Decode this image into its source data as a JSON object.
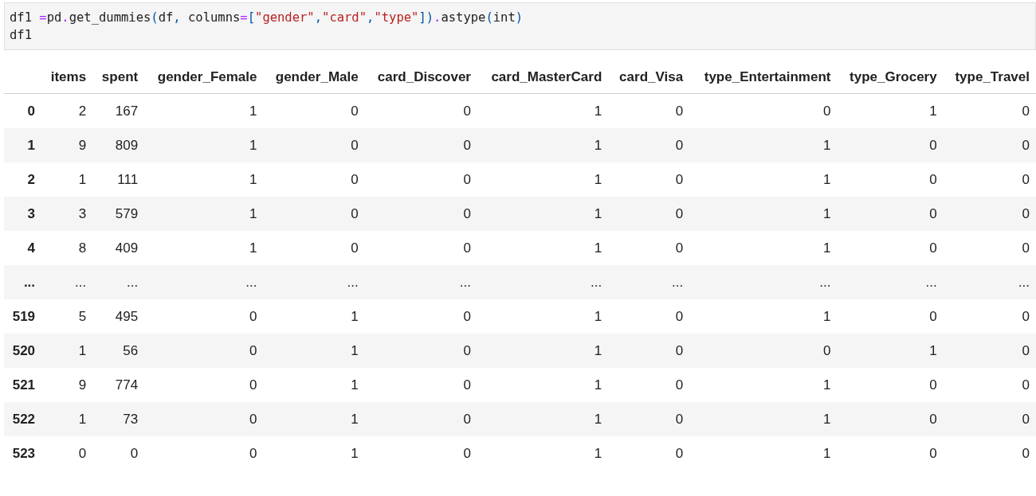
{
  "code_cell": {
    "lines": [
      [
        {
          "kind": "name",
          "text": "df1 "
        },
        {
          "kind": "op",
          "text": "="
        },
        {
          "kind": "name",
          "text": "pd"
        },
        {
          "kind": "op",
          "text": "."
        },
        {
          "kind": "name",
          "text": "get_dummies"
        },
        {
          "kind": "punct",
          "text": "("
        },
        {
          "kind": "name",
          "text": "df"
        },
        {
          "kind": "punct",
          "text": ","
        },
        {
          "kind": "name",
          "text": " columns"
        },
        {
          "kind": "op",
          "text": "="
        },
        {
          "kind": "punct",
          "text": "["
        },
        {
          "kind": "string",
          "text": "\"gender\""
        },
        {
          "kind": "punct",
          "text": ","
        },
        {
          "kind": "string",
          "text": "\"card\""
        },
        {
          "kind": "punct",
          "text": ","
        },
        {
          "kind": "string",
          "text": "\"type\""
        },
        {
          "kind": "punct",
          "text": "])"
        },
        {
          "kind": "op",
          "text": "."
        },
        {
          "kind": "name",
          "text": "astype"
        },
        {
          "kind": "punct",
          "text": "("
        },
        {
          "kind": "name",
          "text": "int"
        },
        {
          "kind": "punct",
          "text": ")"
        }
      ],
      [
        {
          "kind": "name",
          "text": "df1"
        }
      ]
    ]
  },
  "table": {
    "columns": [
      "items",
      "spent",
      "gender_Female",
      "gender_Male",
      "card_Discover",
      "card_MasterCard",
      "card_Visa",
      "type_Entertainment",
      "type_Grocery",
      "type_Travel"
    ],
    "rows": [
      {
        "index": "0",
        "cells": [
          "2",
          "167",
          "1",
          "0",
          "0",
          "1",
          "0",
          "0",
          "1",
          "0"
        ]
      },
      {
        "index": "1",
        "cells": [
          "9",
          "809",
          "1",
          "0",
          "0",
          "1",
          "0",
          "1",
          "0",
          "0"
        ]
      },
      {
        "index": "2",
        "cells": [
          "1",
          "111",
          "1",
          "0",
          "0",
          "1",
          "0",
          "1",
          "0",
          "0"
        ]
      },
      {
        "index": "3",
        "cells": [
          "3",
          "579",
          "1",
          "0",
          "0",
          "1",
          "0",
          "1",
          "0",
          "0"
        ]
      },
      {
        "index": "4",
        "cells": [
          "8",
          "409",
          "1",
          "0",
          "0",
          "1",
          "0",
          "1",
          "0",
          "0"
        ]
      },
      {
        "index": "...",
        "cells": [
          "...",
          "...",
          "...",
          "...",
          "...",
          "...",
          "...",
          "...",
          "...",
          "..."
        ]
      },
      {
        "index": "519",
        "cells": [
          "5",
          "495",
          "0",
          "1",
          "0",
          "1",
          "0",
          "1",
          "0",
          "0"
        ]
      },
      {
        "index": "520",
        "cells": [
          "1",
          "56",
          "0",
          "1",
          "0",
          "1",
          "0",
          "0",
          "1",
          "0"
        ]
      },
      {
        "index": "521",
        "cells": [
          "9",
          "774",
          "0",
          "1",
          "0",
          "1",
          "0",
          "1",
          "0",
          "0"
        ]
      },
      {
        "index": "522",
        "cells": [
          "1",
          "73",
          "0",
          "1",
          "0",
          "1",
          "0",
          "1",
          "0",
          "0"
        ]
      },
      {
        "index": "523",
        "cells": [
          "0",
          "0",
          "0",
          "1",
          "0",
          "1",
          "0",
          "1",
          "0",
          "0"
        ]
      }
    ]
  }
}
